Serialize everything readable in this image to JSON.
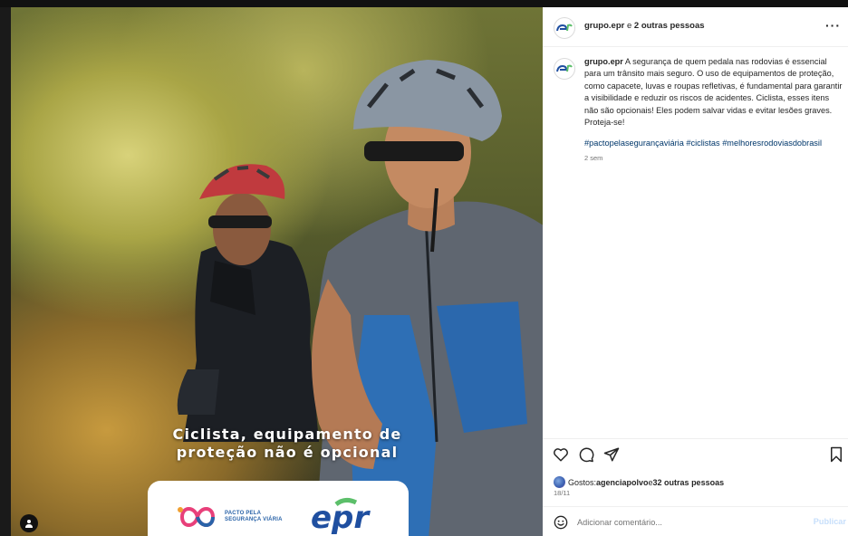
{
  "post": {
    "image_headline_line1": "Ciclista, equipamento de",
    "image_headline_line2": "proteção não é opcional",
    "logo_pacto_line1": "PACTO PELA",
    "logo_pacto_line2": "SEGURANÇA VIÁRIA",
    "logo_epr_text": "epr"
  },
  "header": {
    "username": "grupo.epr",
    "collab_connector": " e ",
    "collab_others": "2 outras pessoas",
    "more_label": "···"
  },
  "caption": {
    "username": "grupo.epr",
    "text": "A segurança de quem pedala nas rodovias é essencial para um trânsito mais seguro. O uso de equipamentos de proteção, como capacete, luvas e roupas refletivas, é fundamental para garantir a visibilidade e reduzir os riscos de acidentes. Ciclista, esses itens não são opcionais! Eles podem salvar vidas e evitar lesões graves. Proteja-se!",
    "hashtags": "#pactopelasegurançaviária #ciclistas #melhoresrodoviasdobrasil",
    "time": "2 sem"
  },
  "actions": {
    "icons": [
      "heart-icon",
      "comment-icon",
      "share-icon",
      "bookmark-icon"
    ]
  },
  "likes": {
    "prefix": "Gostos: ",
    "first_user": "agenciapolvo",
    "connector": " e ",
    "others": "32 outras pessoas"
  },
  "date": "18/11",
  "comment_box": {
    "placeholder": "Adicionar comentário...",
    "publish_label": "Publicar"
  },
  "colors": {
    "link": "#00376b",
    "muted": "#737373",
    "publish_disabled": "#c7dffb",
    "brand_blue": "#1f4fa0",
    "brand_green": "#5cbf6a"
  }
}
